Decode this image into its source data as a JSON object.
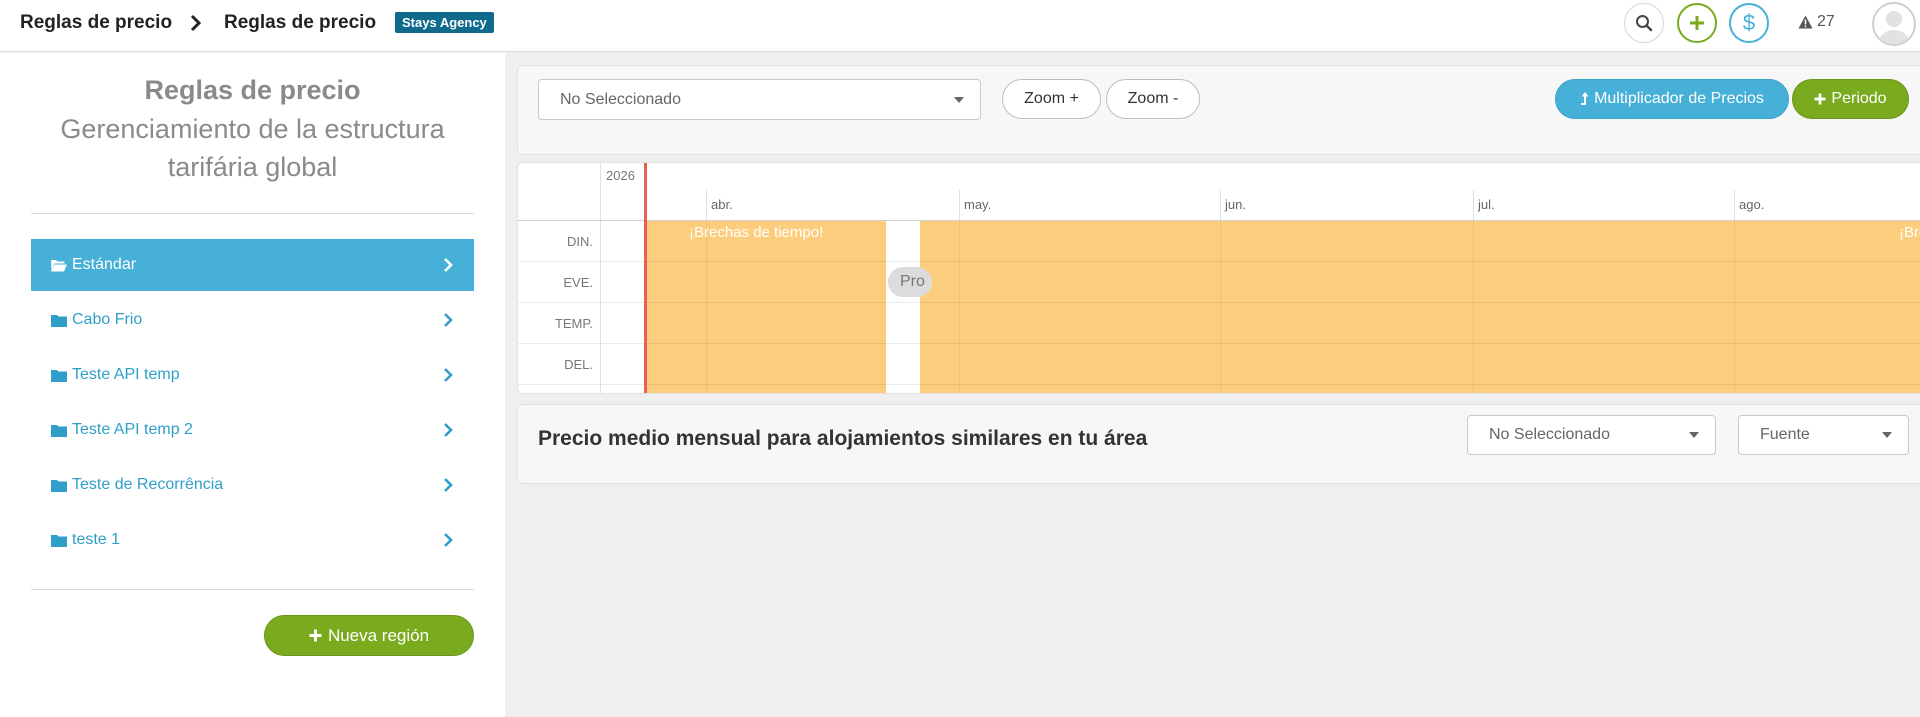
{
  "header": {
    "breadcrumb_root": "Reglas de precio",
    "breadcrumb_current": "Reglas de precio",
    "agency_badge": "Stays Agency",
    "alerts_count": "27"
  },
  "sidebar": {
    "title": "Reglas de precio",
    "subtitle": "Gerenciamiento de la estructura tarifária global",
    "items": [
      {
        "label": "Estándar",
        "active": true
      },
      {
        "label": "Cabo Frio",
        "active": false
      },
      {
        "label": "Teste API temp",
        "active": false
      },
      {
        "label": "Teste API temp 2",
        "active": false
      },
      {
        "label": "Teste de Recorrência",
        "active": false
      },
      {
        "label": "teste 1",
        "active": false
      }
    ],
    "new_region_label": "Nueva región"
  },
  "toolbar": {
    "select_value": "No Seleccionado",
    "zoom_in_label": "Zoom +",
    "zoom_out_label": "Zoom -",
    "multiplier_label": "Multiplicador de Precios",
    "period_label": "Periodo"
  },
  "timeline": {
    "year": "2026",
    "months": [
      "abr.",
      "may.",
      "jun.",
      "jul.",
      "ago."
    ],
    "row_labels": [
      "DIN.",
      "EVE.",
      "TEMP.",
      "DEL."
    ],
    "gap_label": "¡Brechas de tiempo!",
    "gap_label_clipped": "¡Bre",
    "event_label_clipped": "Pro"
  },
  "comparison": {
    "title": "Precio medio mensual para alojamientos similares en tu área",
    "select_value": "No Seleccionado",
    "source_placeholder": "Fuente"
  },
  "colors": {
    "accent_blue": "#46b0d8",
    "accent_green": "#7aab1e",
    "period_fill": "#fdcd7e",
    "today_line": "#e8614f",
    "badge": "#0f6a8b"
  }
}
